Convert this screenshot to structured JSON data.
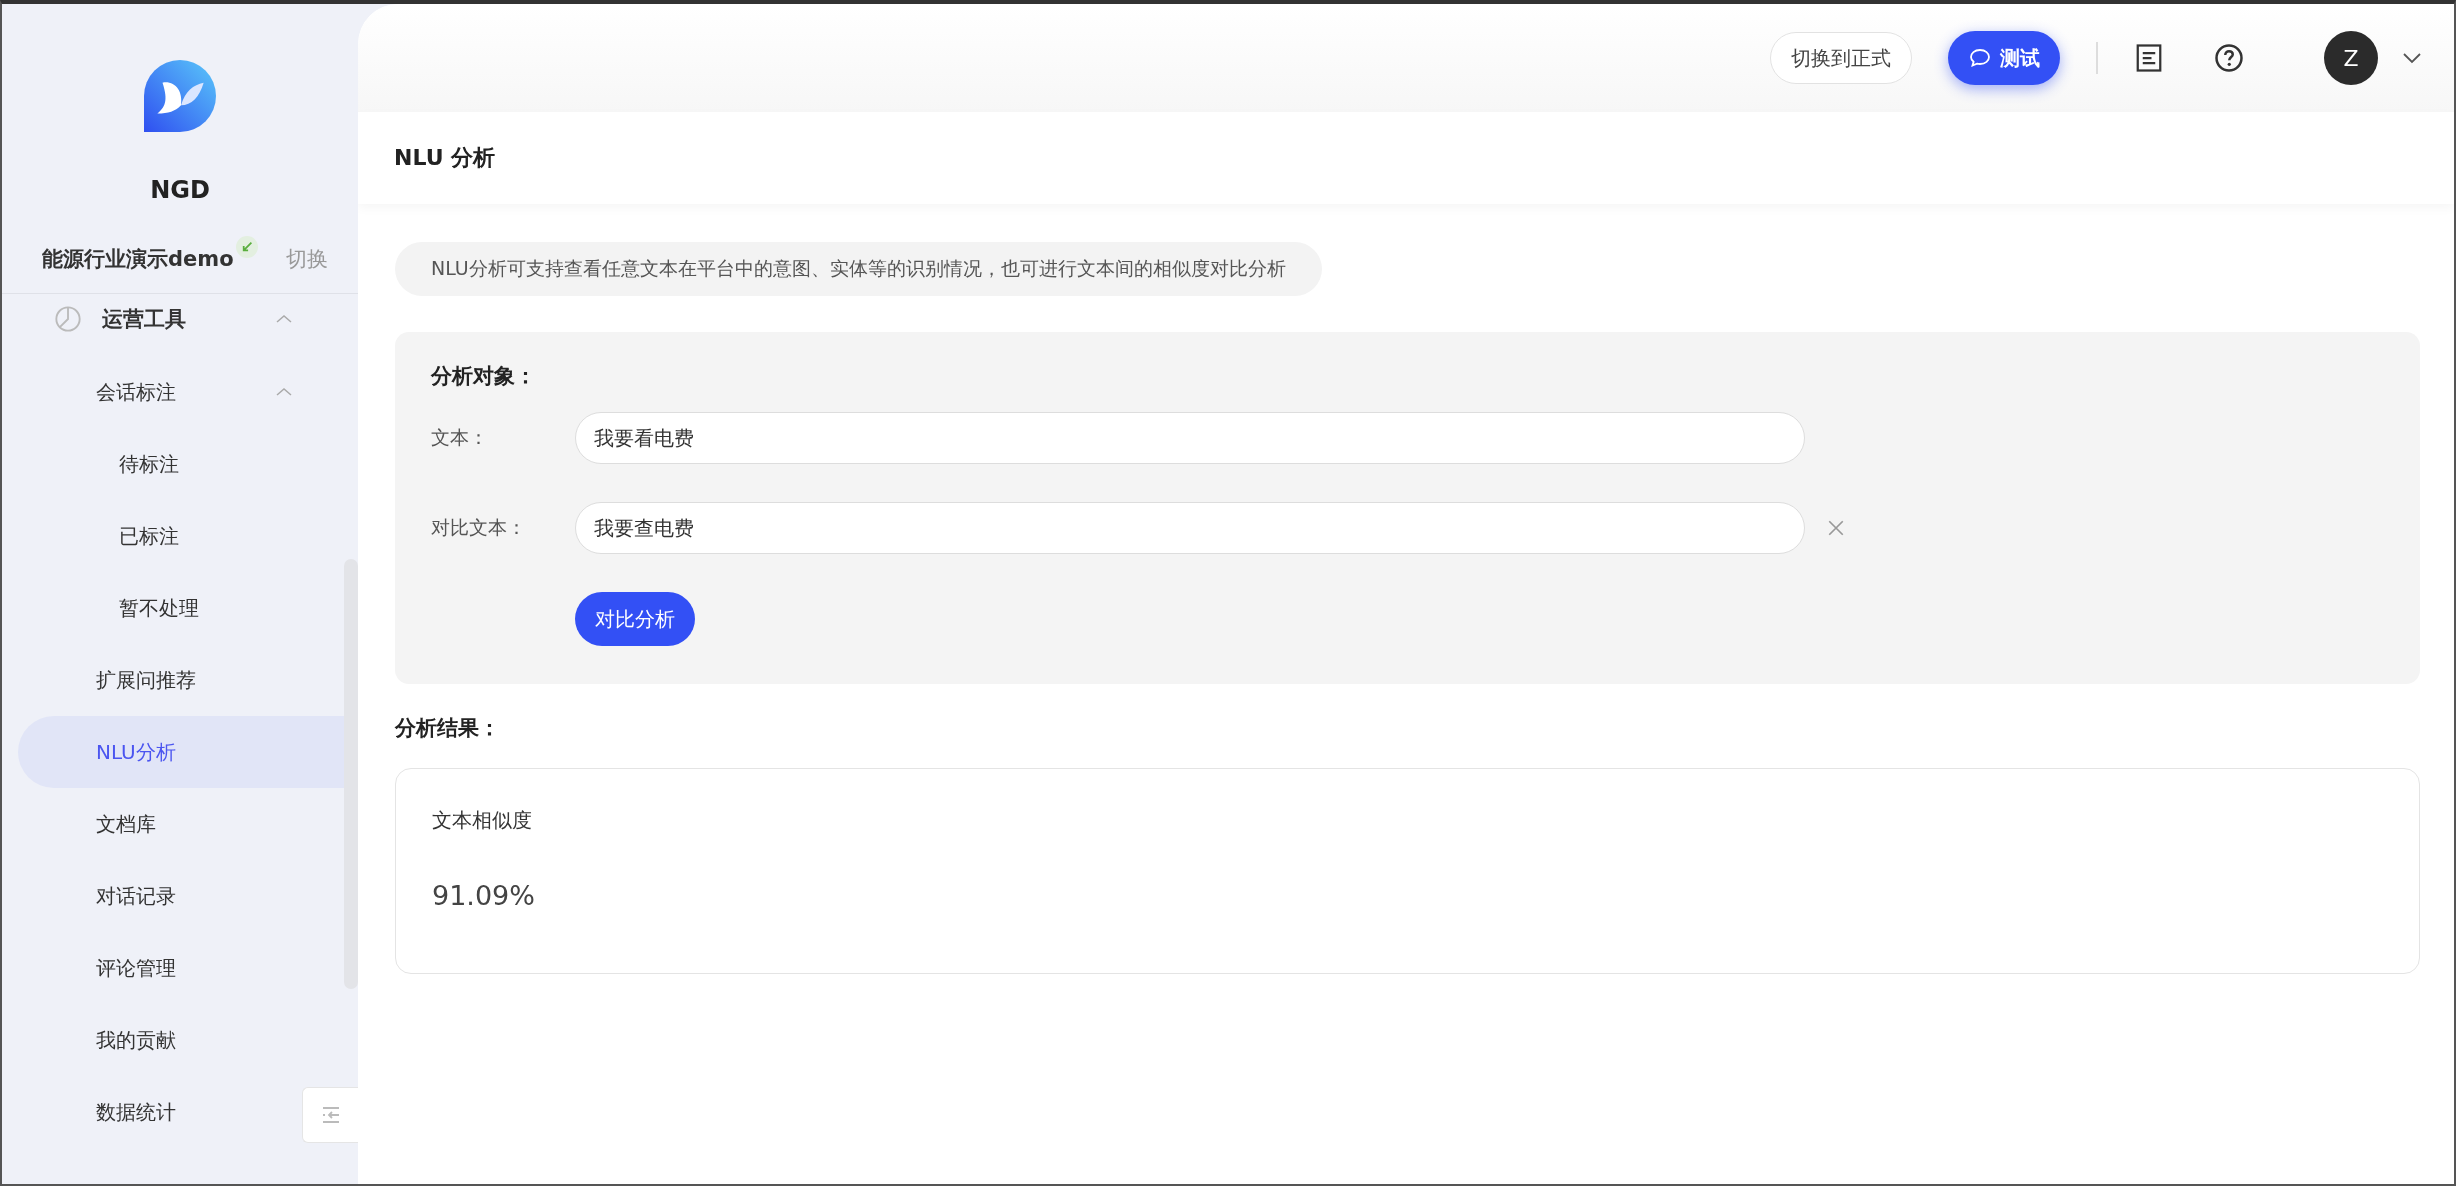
{
  "sidebar": {
    "brand": "NGD",
    "project": {
      "name": "能源行业演示demo",
      "switch": "切换"
    },
    "menu": [
      {
        "label": "运营工具",
        "kind": "group",
        "expanded": true,
        "selected": false,
        "children": [
          {
            "label": "会话标注",
            "kind": "folder",
            "expanded": true,
            "selected": false,
            "children": [
              {
                "label": "待标注",
                "kind": "leaf",
                "selected": false
              },
              {
                "label": "已标注",
                "kind": "leaf",
                "selected": false
              },
              {
                "label": "暂不处理",
                "kind": "leaf",
                "selected": false
              }
            ]
          },
          {
            "label": "扩展问推荐",
            "kind": "leaf",
            "selected": false
          },
          {
            "label": "NLU分析",
            "kind": "leaf",
            "selected": true
          },
          {
            "label": "文档库",
            "kind": "leaf",
            "selected": false
          },
          {
            "label": "对话记录",
            "kind": "leaf",
            "selected": false
          },
          {
            "label": "评论管理",
            "kind": "leaf",
            "selected": false
          },
          {
            "label": "我的贡献",
            "kind": "leaf",
            "selected": false
          },
          {
            "label": "数据统计",
            "kind": "leaf",
            "selected": false
          }
        ]
      }
    ]
  },
  "topbar": {
    "switch_button": "切换到正式",
    "test_button": "测试",
    "avatar": "Z"
  },
  "page": {
    "title": "NLU 分析",
    "notice": "NLU分析可支持查看任意文本在平台中的意图、实体等的识别情况，也可进行文本间的相似度对比分析",
    "form": {
      "heading": "分析对象：",
      "fields": [
        {
          "label": "文本：",
          "value": "我要看电费",
          "clearable": false
        },
        {
          "label": "对比文本：",
          "value": "我要查电费",
          "clearable": true
        }
      ],
      "submit": "对比分析"
    },
    "result": {
      "heading": "分析结果：",
      "metric_label": "文本相似度",
      "metric_value": "91.09%"
    }
  }
}
